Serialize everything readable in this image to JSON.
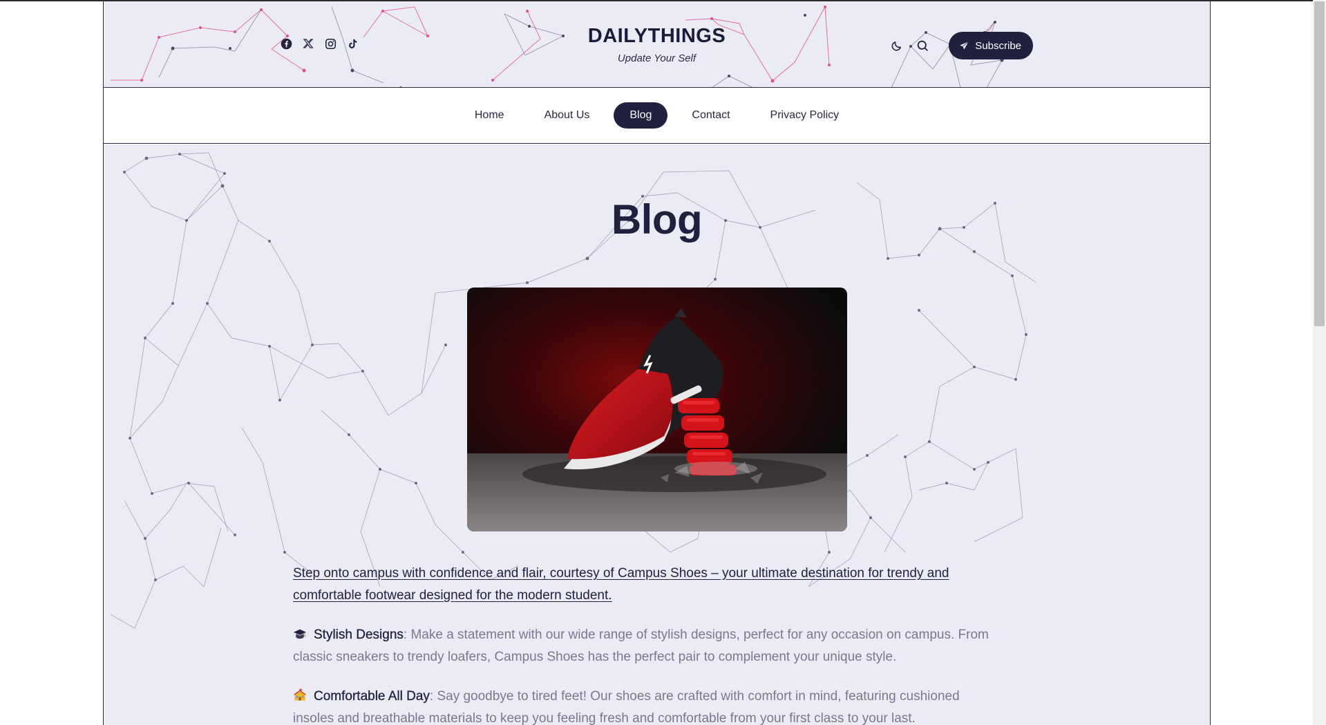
{
  "site": {
    "title": "DAILYTHINGS",
    "tagline": "Update Your Self"
  },
  "socials": [
    {
      "icon": "facebook-icon"
    },
    {
      "icon": "x-icon"
    },
    {
      "icon": "instagram-icon"
    },
    {
      "icon": "tiktok-icon"
    }
  ],
  "header_actions": {
    "dark_mode_icon": "moon-icon",
    "search_icon": "search-icon",
    "subscribe_label": "Subscribe"
  },
  "nav": {
    "items": [
      {
        "label": "Home",
        "active": false
      },
      {
        "label": "About Us",
        "active": false
      },
      {
        "label": "Blog",
        "active": true
      },
      {
        "label": "Contact",
        "active": false
      },
      {
        "label": "Privacy Policy",
        "active": false
      }
    ]
  },
  "main": {
    "heading": "Blog",
    "hero_image": "red-black-running-shoe",
    "lead_link": "Step onto campus with confidence and flair, courtesy of Campus Shoes – your ultimate destination for trendy and comfortable footwear designed for the modern student.",
    "features": [
      {
        "emoji": "graduation-cap-emoji",
        "title": "Stylish Designs",
        "text": ": Make a statement with our wide range of stylish designs, perfect for any occasion on campus. From classic sneakers to trendy loafers, Campus Shoes has the perfect pair to complement your unique style."
      },
      {
        "emoji": "school-emoji",
        "title": "Comfortable All Day",
        "text": ": Say goodbye to tired feet! Our shoes are crafted with comfort in mind, featuring cushioned insoles and breathable materials to keep you feeling fresh and comfortable from your first class to your last."
      }
    ]
  },
  "colors": {
    "primary": "#22203f",
    "background": "#ebebf6",
    "accent_network": "#e0508a",
    "body_text": "#7a7890"
  }
}
